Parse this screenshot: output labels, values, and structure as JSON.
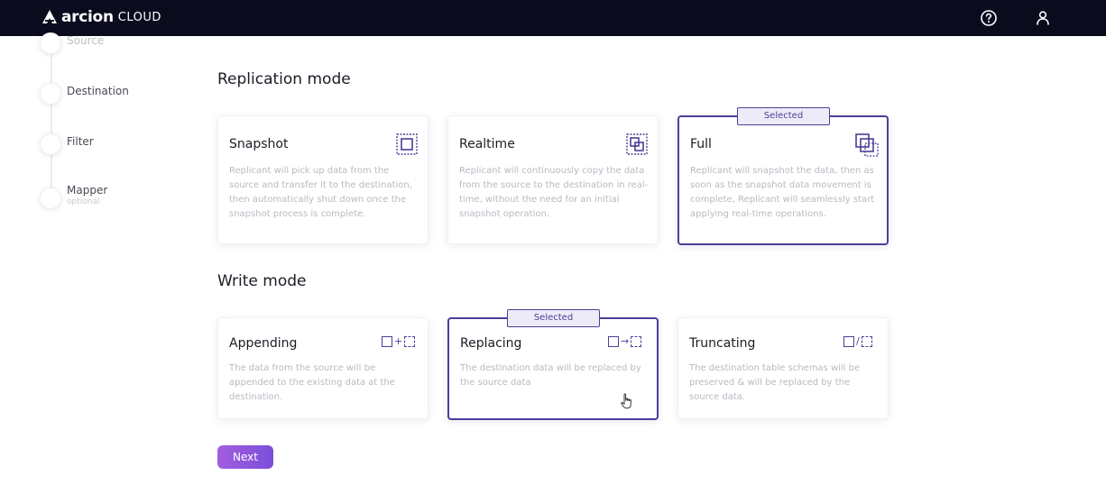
{
  "brand": {
    "name": "arcion",
    "suffix": "CLOUD"
  },
  "header": {
    "help_icon": "help-circle-icon",
    "user_icon": "user-icon"
  },
  "stepper": {
    "steps": [
      {
        "label": "Source",
        "sub": ""
      },
      {
        "label": "Destination",
        "sub": ""
      },
      {
        "label": "Filter",
        "sub": ""
      },
      {
        "label": "Mapper",
        "sub": "optional"
      }
    ]
  },
  "replication": {
    "title": "Replication mode",
    "cards": [
      {
        "title": "Snapshot",
        "desc": "Replicant will pick up data from the source and transfer it to the destination, then automatically shut down once the snapshot process is complete.",
        "selected": false
      },
      {
        "title": "Realtime",
        "desc": "Replicant will continuously copy the data from the source to the destination in real-time, without the need for an initial snapshot operation.",
        "selected": false
      },
      {
        "title": "Full",
        "desc": "Replicant will snapshot the data, then as soon as the snapshot data movement is complete, Replicant will seamlessly start applying real-time operations.",
        "selected": true,
        "badge": "Selected"
      }
    ]
  },
  "write": {
    "title": "Write mode",
    "cards": [
      {
        "title": "Appending",
        "desc": "The data from the source will be appended to the existing data at the destination.",
        "selected": false,
        "icon_sep": "+"
      },
      {
        "title": "Replacing",
        "desc": "The destination data will be replaced by the source data",
        "selected": true,
        "badge": "Selected",
        "icon_sep": "→"
      },
      {
        "title": "Truncating",
        "desc": "The destination table schemas will be preserved & will be replaced by the source data.",
        "selected": false,
        "icon_sep": "/"
      }
    ]
  },
  "actions": {
    "next_label": "Next"
  },
  "colors": {
    "topbar": "#0b0b1e",
    "accent": "#4b3f97",
    "button_start": "#a35de0",
    "button_end": "#7a4fd8"
  }
}
